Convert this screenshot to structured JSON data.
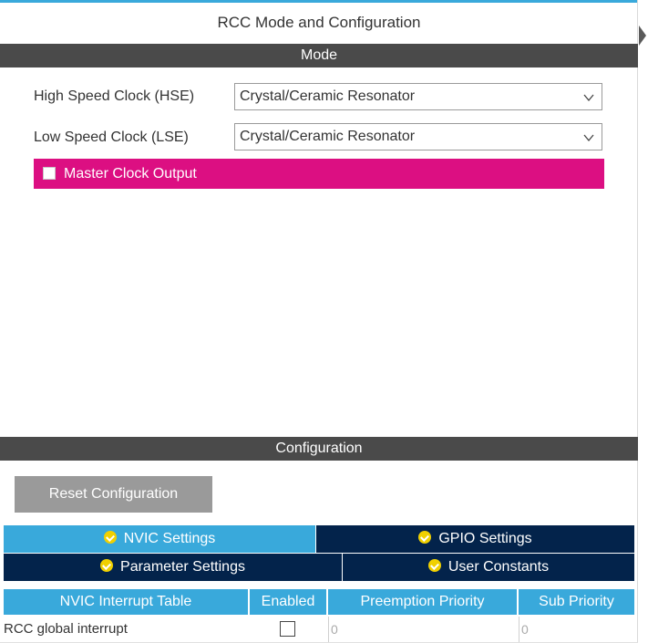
{
  "panel": {
    "title": "RCC Mode and Configuration"
  },
  "mode": {
    "header": "Mode",
    "hse": {
      "label": "High Speed Clock (HSE)",
      "value": "Crystal/Ceramic Resonator"
    },
    "lse": {
      "label": "Low Speed Clock (LSE)",
      "value": "Crystal/Ceramic Resonator"
    },
    "master_clock_output": {
      "label": "Master Clock Output",
      "checked": false
    }
  },
  "configuration": {
    "header": "Configuration",
    "reset_label": "Reset Configuration",
    "tabs": [
      {
        "label": "NVIC Settings",
        "active": true
      },
      {
        "label": "GPIO Settings",
        "active": false
      },
      {
        "label": "Parameter Settings",
        "active": false
      },
      {
        "label": "User Constants",
        "active": false
      }
    ],
    "table": {
      "columns": [
        "NVIC Interrupt Table",
        "Enabled",
        "Preemption Priority",
        "Sub Priority"
      ],
      "rows": [
        {
          "name": "RCC global interrupt",
          "enabled": false,
          "preemption": "0",
          "sub": "0"
        }
      ]
    }
  },
  "colors": {
    "accent": "#39a9db",
    "dark_tab": "#03234b",
    "header_bar": "#4a4a4a",
    "mco_active": "#dc0f82",
    "check_badge": "#f0d000"
  }
}
